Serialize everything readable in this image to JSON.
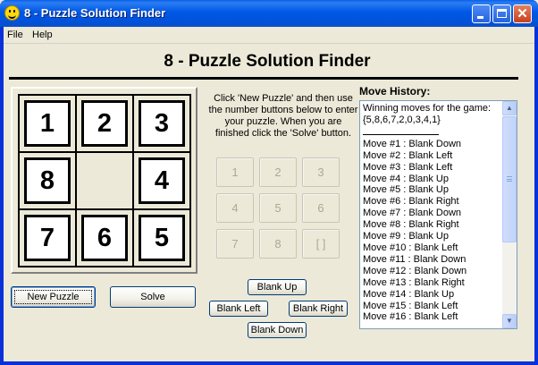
{
  "window": {
    "title": "8 - Puzzle Solution Finder"
  },
  "menu": {
    "file": "File",
    "help": "Help"
  },
  "heading": "8 - Puzzle Solution Finder",
  "board": {
    "tiles": [
      [
        "1",
        "2",
        "3"
      ],
      [
        "8",
        "",
        "4"
      ],
      [
        "7",
        "6",
        "5"
      ]
    ]
  },
  "instructions": "Click 'New Puzzle' and then use the number buttons below to enter your puzzle. When you are finished click the 'Solve' button.",
  "keypad": [
    "1",
    "2",
    "3",
    "4",
    "5",
    "6",
    "7",
    "8",
    "[  ]"
  ],
  "buttons": {
    "new_puzzle": "New Puzzle",
    "solve": "Solve",
    "blank_up": "Blank Up",
    "blank_left": "Blank Left",
    "blank_right": "Blank Right",
    "blank_down": "Blank Down"
  },
  "history": {
    "label": "Move History:",
    "intro_1": "Winning moves for the game:",
    "intro_2": "{5,8,6,7,2,0,3,4,1}",
    "moves": [
      "Move #1 : Blank Down",
      "Move #2 : Blank Left",
      "Move #3 : Blank Left",
      "Move #4 : Blank Up",
      "Move #5 : Blank Up",
      "Move #6 : Blank Right",
      "Move #7 : Blank Down",
      "Move #8 : Blank Right",
      "Move #9 : Blank Up",
      "Move #10 : Blank Left",
      "Move #11 : Blank Down",
      "Move #12 : Blank Down",
      "Move #13 : Blank Right",
      "Move #14 : Blank Up",
      "Move #15 : Blank Left",
      "Move #16 : Blank Left"
    ]
  }
}
